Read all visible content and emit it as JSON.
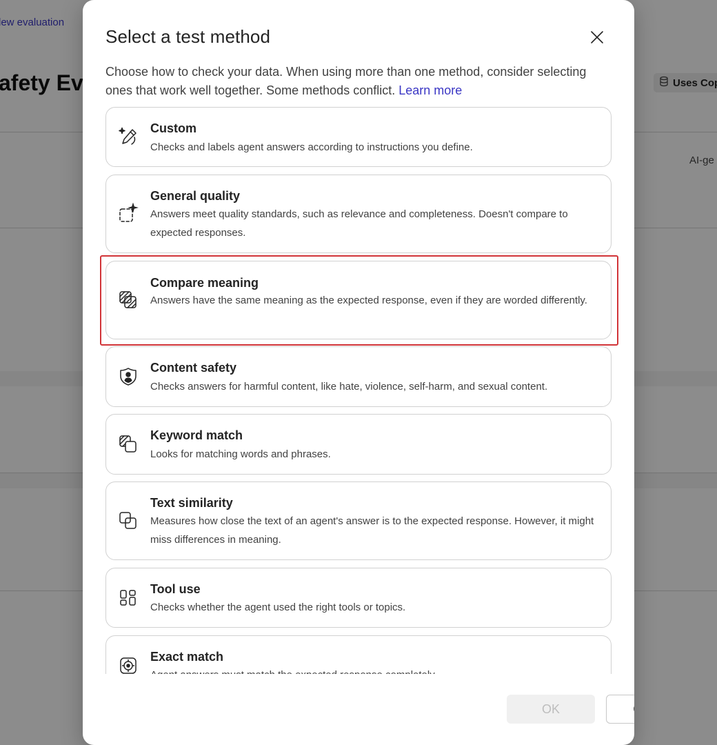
{
  "background": {
    "link_text": "lew evaluation",
    "page_title": "afety Eval",
    "badge_label": "Uses Cop",
    "side_label": "AI-ge"
  },
  "dialog": {
    "title": "Select a test method",
    "description": "Choose how to check your data. When using more than one method, consider selecting ones that work well together. Some methods conflict.",
    "learn_more": "Learn more",
    "highlighted_option": "Compare meaning",
    "options": [
      {
        "title": "Custom",
        "description": "Checks and labels agent answers according to instructions you define.",
        "icon": "pen-sparkle-icon"
      },
      {
        "title": "General quality",
        "description": "Answers meet quality standards, such as relevance and completeness. Doesn't compare to expected responses.",
        "icon": "dashed-sparkle-icon"
      },
      {
        "title": "Compare meaning",
        "description": "Answers have the same meaning as the expected response, even if they are worded differently.",
        "icon": "hatched-squares-icon"
      },
      {
        "title": "Content safety",
        "description": "Checks answers for harmful content, like hate, violence, self-harm, and sexual content.",
        "icon": "shield-person-icon"
      },
      {
        "title": "Keyword match",
        "description": "Looks for matching words and phrases.",
        "icon": "overlap-squares-icon"
      },
      {
        "title": "Text similarity",
        "description": "Measures how close the text of an agent's answer is to the expected response. However, it might miss differences in meaning.",
        "icon": "overlap-rounded-squares-icon"
      },
      {
        "title": "Tool use",
        "description": "Checks whether the agent used the right tools or topics.",
        "icon": "apps-grid-icon"
      },
      {
        "title": "Exact match",
        "description": "Agent answers must match the expected response completely.",
        "icon": "target-icon"
      }
    ],
    "ok_label": "OK",
    "close_label": "Close"
  }
}
